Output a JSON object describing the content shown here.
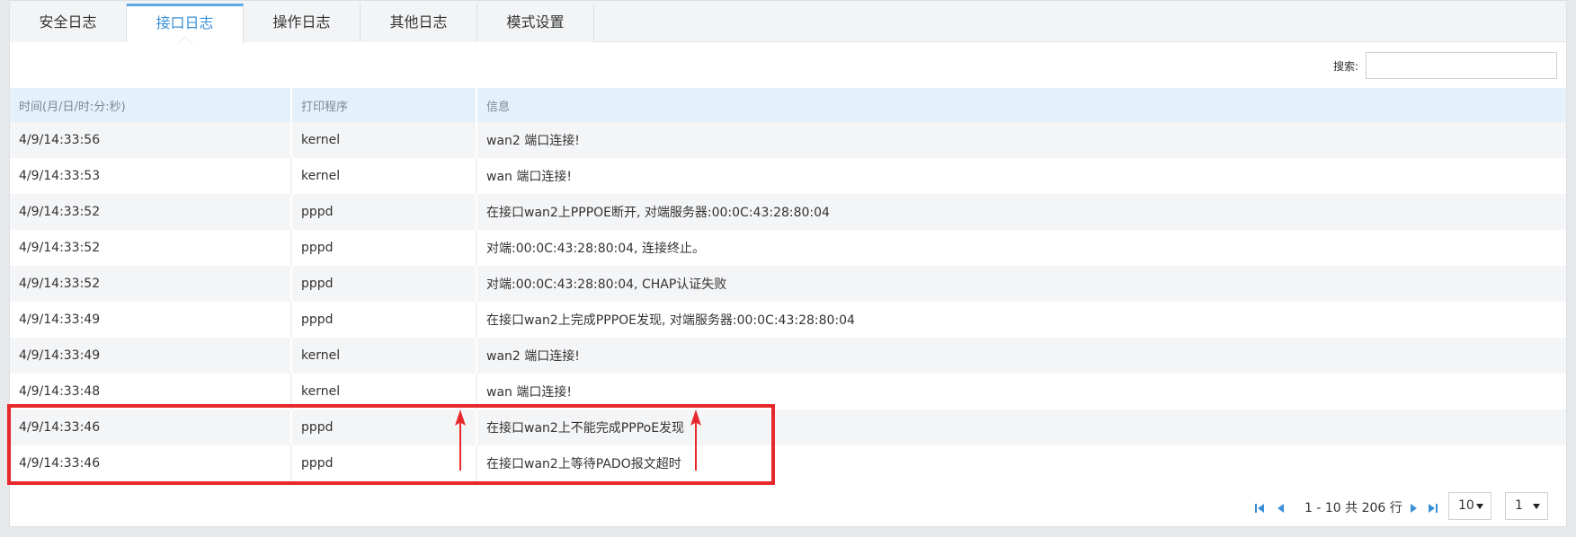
{
  "tabs": [
    {
      "label": "安全日志",
      "active": false
    },
    {
      "label": "接口日志",
      "active": true
    },
    {
      "label": "操作日志",
      "active": false
    },
    {
      "label": "其他日志",
      "active": false
    },
    {
      "label": "模式设置",
      "active": false
    }
  ],
  "search": {
    "label": "搜索:",
    "value": ""
  },
  "table": {
    "columns": [
      "时间(月/日/时:分:秒)",
      "打印程序",
      "信息"
    ],
    "rows": [
      [
        "4/9/14:33:56",
        "kernel",
        "wan2 端口连接!"
      ],
      [
        "4/9/14:33:53",
        "kernel",
        "wan 端口连接!"
      ],
      [
        "4/9/14:33:52",
        "pppd",
        "在接口wan2上PPPOE断开, 对端服务器:00:0C:43:28:80:04"
      ],
      [
        "4/9/14:33:52",
        "pppd",
        "对端:00:0C:43:28:80:04, 连接终止。"
      ],
      [
        "4/9/14:33:52",
        "pppd",
        "对端:00:0C:43:28:80:04, CHAP认证失败"
      ],
      [
        "4/9/14:33:49",
        "pppd",
        "在接口wan2上完成PPPOE发现, 对端服务器:00:0C:43:28:80:04"
      ],
      [
        "4/9/14:33:49",
        "kernel",
        "wan2 端口连接!"
      ],
      [
        "4/9/14:33:48",
        "kernel",
        "wan 端口连接!"
      ],
      [
        "4/9/14:33:46",
        "pppd",
        "在接口wan2上不能完成PPPoE发现"
      ],
      [
        "4/9/14:33:46",
        "pppd",
        "在接口wan2上等待PADO报文超时"
      ]
    ]
  },
  "pagination": {
    "range_text": "1 - 10 共 206 行",
    "page_size": "10",
    "page": "1",
    "icons": [
      "first-page-icon",
      "prev-page-icon",
      "next-page-icon",
      "last-page-icon"
    ],
    "icon_color": "#3b8fd8"
  },
  "annotation": {
    "color": "#e8282b"
  }
}
